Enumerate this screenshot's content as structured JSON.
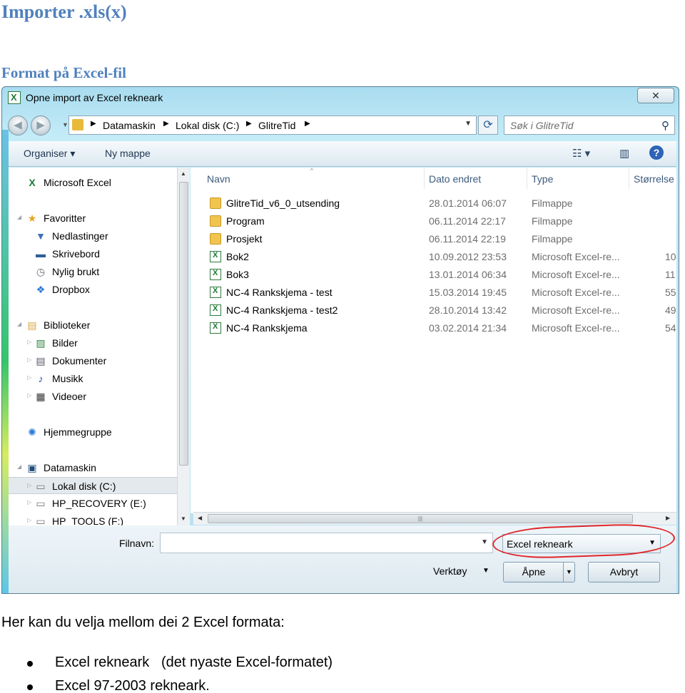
{
  "document": {
    "heading": "Importer .xls(x)",
    "subheading": "Format på Excel-fil",
    "paragraph": "Her kan du velja mellom dei 2 Excel formata:",
    "bullets": [
      "Excel rekneark   (det nyaste Excel-formatet)",
      "Excel 97-2003 rekneark."
    ]
  },
  "dialog": {
    "title": "Opne import av Excel rekneark",
    "close_label": "✕",
    "address": {
      "crumbs": [
        "Datamaskin",
        "Lokal disk (C:)",
        "GlitreTid"
      ]
    },
    "search_placeholder": "Søk i GlitreTid",
    "toolbar": {
      "organize": "Organiser",
      "new_folder": "Ny mappe"
    },
    "nav": [
      {
        "label": "Microsoft Excel",
        "icon": "excel-icon"
      },
      {
        "label": "Favoritter",
        "icon": "star-icon"
      },
      {
        "label": "Nedlastinger",
        "icon": "downloads-icon"
      },
      {
        "label": "Skrivebord",
        "icon": "desktop-icon"
      },
      {
        "label": "Nylig brukt",
        "icon": "recent-icon"
      },
      {
        "label": "Dropbox",
        "icon": "dropbox-icon"
      },
      {
        "label": "Biblioteker",
        "icon": "libraries-icon"
      },
      {
        "label": "Bilder",
        "icon": "pictures-icon"
      },
      {
        "label": "Dokumenter",
        "icon": "documents-icon"
      },
      {
        "label": "Musikk",
        "icon": "music-icon"
      },
      {
        "label": "Videoer",
        "icon": "videos-icon"
      },
      {
        "label": "Hjemmegruppe",
        "icon": "homegroup-icon"
      },
      {
        "label": "Datamaskin",
        "icon": "computer-icon"
      },
      {
        "label": "Lokal disk (C:)",
        "icon": "disk-icon"
      },
      {
        "label": "HP_RECOVERY (E:)",
        "icon": "drive-icon"
      },
      {
        "label": "HP_TOOLS (F:)",
        "icon": "drive-icon"
      }
    ],
    "columns": {
      "name": "Navn",
      "date": "Dato endret",
      "type": "Type",
      "size": "Størrelse"
    },
    "files": [
      {
        "name": "GlitreTid_v6_0_utsending",
        "date": "28.01.2014 06:07",
        "type": "Filmappe",
        "size": "",
        "kind": "folder"
      },
      {
        "name": "Program",
        "date": "06.11.2014 22:17",
        "type": "Filmappe",
        "size": "",
        "kind": "folder"
      },
      {
        "name": "Prosjekt",
        "date": "06.11.2014 22:19",
        "type": "Filmappe",
        "size": "",
        "kind": "folder"
      },
      {
        "name": "Bok2",
        "date": "10.09.2012 23:53",
        "type": "Microsoft Excel-re...",
        "size": "10",
        "kind": "xls"
      },
      {
        "name": "Bok3",
        "date": "13.01.2014 06:34",
        "type": "Microsoft Excel-re...",
        "size": "11",
        "kind": "xls"
      },
      {
        "name": "NC-4 Rankskjema - test",
        "date": "15.03.2014 19:45",
        "type": "Microsoft Excel-re...",
        "size": "55",
        "kind": "xls"
      },
      {
        "name": "NC-4 Rankskjema - test2",
        "date": "28.10.2014 13:42",
        "type": "Microsoft Excel-re...",
        "size": "49",
        "kind": "xls"
      },
      {
        "name": "NC-4 Rankskjema",
        "date": "03.02.2014 21:34",
        "type": "Microsoft Excel-re...",
        "size": "54",
        "kind": "xls"
      }
    ],
    "filename_label": "Filnavn:",
    "filename_value": "",
    "filetype_selected": "Excel rekneark",
    "tools_label": "Verktøy",
    "open_label": "Åpne",
    "cancel_label": "Avbryt",
    "colors": {
      "highlight_ring": "#e0262a",
      "heading": "#4f81bd"
    }
  }
}
